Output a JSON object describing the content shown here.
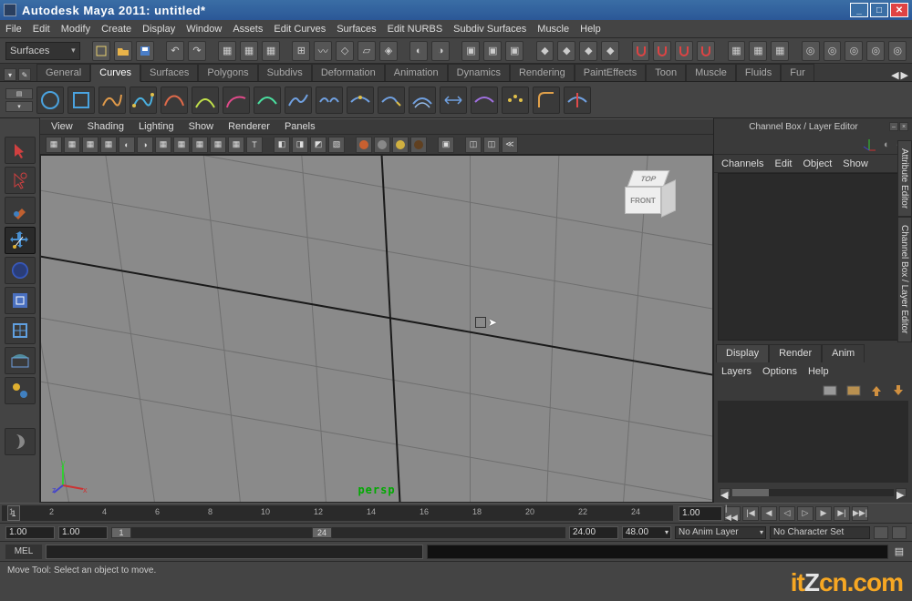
{
  "window": {
    "title": "Autodesk Maya 2011: untitled*"
  },
  "menubar": [
    "File",
    "Edit",
    "Modify",
    "Create",
    "Display",
    "Window",
    "Assets",
    "Edit Curves",
    "Surfaces",
    "Edit NURBS",
    "Subdiv Surfaces",
    "Muscle",
    "Help"
  ],
  "mode_selector": "Surfaces",
  "shelf_tabs": [
    "General",
    "Curves",
    "Surfaces",
    "Polygons",
    "Subdivs",
    "Deformation",
    "Animation",
    "Dynamics",
    "Rendering",
    "PaintEffects",
    "Toon",
    "Muscle",
    "Fluids",
    "Fur"
  ],
  "shelf_active_idx": 1,
  "panel_menu": [
    "View",
    "Shading",
    "Lighting",
    "Show",
    "Renderer",
    "Panels"
  ],
  "viewport": {
    "label": "persp",
    "cube_top": "TOP",
    "cube_front": "FRONT"
  },
  "channelbox": {
    "title": "Channel Box / Layer Editor",
    "toprow": [
      "Channels",
      "Edit",
      "Object",
      "Show"
    ],
    "section_tabs": [
      "Display",
      "Render",
      "Anim"
    ],
    "section_active_idx": 0,
    "layer_menu": [
      "Layers",
      "Options",
      "Help"
    ]
  },
  "side_tabs": [
    "Attribute Editor",
    "Channel Box / Layer Editor"
  ],
  "timeline": {
    "ticks": [
      1,
      2,
      4,
      6,
      8,
      10,
      12,
      14,
      16,
      18,
      20,
      22,
      24
    ],
    "current": "1",
    "frame_field": "1.00"
  },
  "range": {
    "start_outer": "1.00",
    "start_inner": "1.00",
    "slider_left": "1",
    "slider_right": "24",
    "end_inner": "24.00",
    "end_outer": "48.00",
    "anim_layer": "No Anim Layer",
    "char_set": "No Character Set"
  },
  "cmdline": {
    "lang": "MEL"
  },
  "status": "Move Tool: Select an object to move.",
  "watermark": {
    "pre": "it",
    "mid": "Z",
    "post": "cn.com"
  }
}
